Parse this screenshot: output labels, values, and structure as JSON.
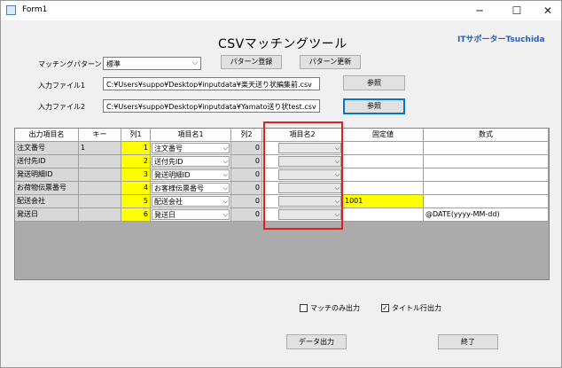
{
  "window": {
    "title": "Form1",
    "min_glyph": "─",
    "max_glyph": "☐",
    "close_glyph": "✕"
  },
  "header": {
    "title": "CSVマッチングツール",
    "brand": "ITサポーターTsuchida"
  },
  "pattern": {
    "label": "マッチングパターン",
    "value": "標準",
    "register_button": "パターン登録",
    "update_button": "パターン更新"
  },
  "file1": {
    "label": "入力ファイル1",
    "path": "C:¥Users¥suppo¥Desktop¥inputdata¥楽天送り状編集前.csv",
    "browse": "参照"
  },
  "file2": {
    "label": "入力ファイル2",
    "path": "C:¥Users¥suppo¥Desktop¥inputdata¥Yamato送り状test.csv",
    "browse": "参照"
  },
  "grid": {
    "headers": [
      "出力項目名",
      "キー",
      "列1",
      "項目名1",
      "列2",
      "項目名2",
      "固定値",
      "数式"
    ],
    "rows": [
      {
        "name": "注文番号",
        "key": "1",
        "col1": "1",
        "item1": "注文番号",
        "col2": "0",
        "item2": "",
        "fixed": "",
        "formula": ""
      },
      {
        "name": "送付先ID",
        "key": "",
        "col1": "2",
        "item1": "送付先ID",
        "col2": "0",
        "item2": "",
        "fixed": "",
        "formula": ""
      },
      {
        "name": "発送明細ID",
        "key": "",
        "col1": "3",
        "item1": "発送明細ID",
        "col2": "0",
        "item2": "",
        "fixed": "",
        "formula": ""
      },
      {
        "name": "お荷物伝票番号",
        "key": "",
        "col1": "4",
        "item1": "お客様伝票番号",
        "col2": "0",
        "item2": "",
        "fixed": "",
        "formula": ""
      },
      {
        "name": "配送会社",
        "key": "",
        "col1": "5",
        "item1": "配送会社",
        "col2": "0",
        "item2": "",
        "fixed": "1001",
        "formula": ""
      },
      {
        "name": "発送日",
        "key": "",
        "col1": "6",
        "item1": "発送日",
        "col2": "0",
        "item2": "",
        "fixed": "",
        "formula": "@DATE(yyyy-MM-dd)"
      }
    ],
    "fixed_highlight_row": 4
  },
  "options": {
    "match_only": {
      "label": "マッチのみ出力",
      "checked": false
    },
    "title_row": {
      "label": "タイトル行出力",
      "checked": true
    }
  },
  "actions": {
    "export": "データ出力",
    "exit": "終了"
  },
  "colors": {
    "highlight": "#ffff00",
    "annotation": "#e02020",
    "brand": "#2a5fb0"
  }
}
